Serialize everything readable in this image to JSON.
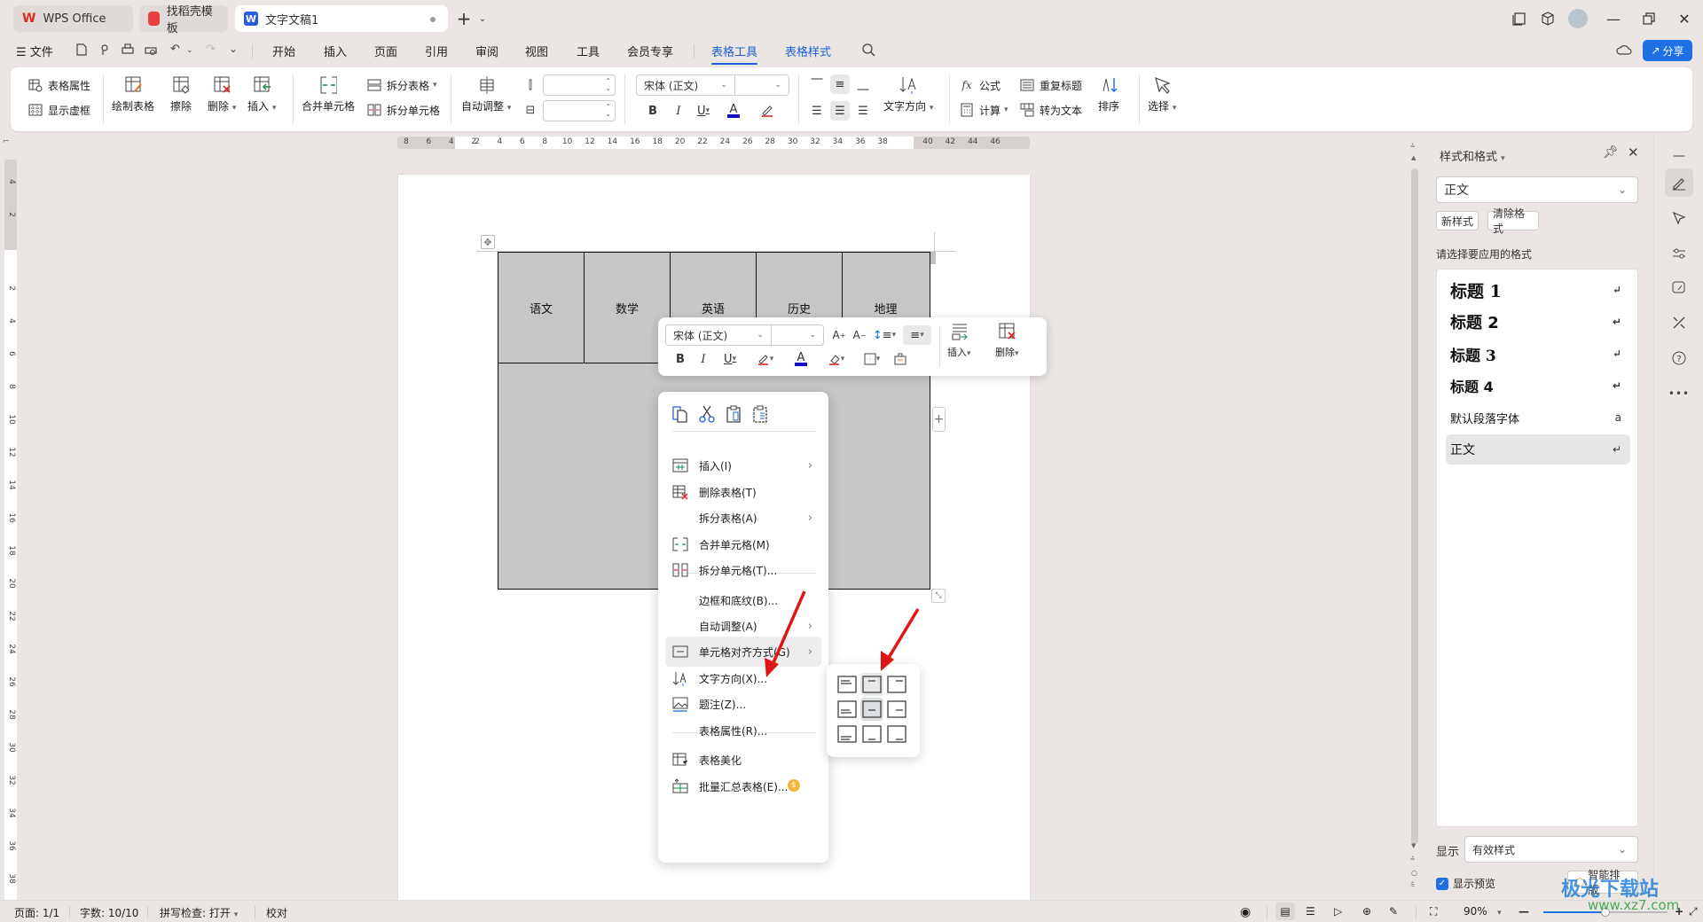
{
  "tabs": [
    {
      "label": "WPS Office",
      "icon": "wps-logo-icon"
    },
    {
      "label": "找稻壳模板",
      "icon": "docer-icon"
    },
    {
      "label": "文字文稿1",
      "icon": "writer-icon",
      "active": true
    }
  ],
  "menu": {
    "file": "文件",
    "items": [
      "开始",
      "插入",
      "页面",
      "引用",
      "审阅",
      "视图",
      "工具",
      "会员专享"
    ],
    "context_tabs": [
      "表格工具",
      "表格样式"
    ],
    "share": "分享"
  },
  "ribbon": {
    "table_props": "表格属性",
    "show_grid": "显示虚框",
    "draw_table": "绘制表格",
    "erase": "擦除",
    "delete": "删除",
    "insert": "插入",
    "merge_cells": "合并单元格",
    "split_table": "拆分表格",
    "split_cells": "拆分单元格",
    "auto_fit": "自动调整",
    "font_name": "宋体 (正文)",
    "font_size": "",
    "row_height": "",
    "col_width": "",
    "text_direction": "文字方向",
    "formula": "公式",
    "calculate": "计算",
    "repeat_header": "重复标题",
    "to_text": "转为文本",
    "sort": "排序",
    "select": "选择"
  },
  "ruler": {
    "h_left": [
      "8",
      "6",
      "4",
      "2"
    ],
    "h_main": [
      "2",
      "4",
      "6",
      "8",
      "10",
      "12",
      "14",
      "16",
      "18",
      "20",
      "22",
      "24",
      "26",
      "28",
      "30",
      "32",
      "34",
      "36",
      "38"
    ],
    "h_right": [
      "40",
      "42",
      "44",
      "46"
    ],
    "v_top": [
      "4",
      "2"
    ],
    "v_main": [
      "2",
      "4",
      "6",
      "8",
      "10",
      "12",
      "14",
      "16",
      "18",
      "20",
      "22",
      "24",
      "26",
      "28",
      "30",
      "32",
      "34",
      "36",
      "38"
    ]
  },
  "document": {
    "table_headers": [
      "语文",
      "数学",
      "英语",
      "历史",
      "地理"
    ]
  },
  "float_toolbar": {
    "font_name": "宋体 (正文)",
    "font_size": "",
    "insert": "插入",
    "delete": "删除"
  },
  "context_menu": {
    "items": [
      {
        "label": "插入(I)",
        "icon": "insert-table-icon",
        "submenu": true
      },
      {
        "label": "删除表格(T)",
        "icon": "delete-table-icon",
        "submenu": false
      },
      {
        "label": "拆分表格(A)",
        "icon": "",
        "submenu": true
      },
      {
        "label": "合并单元格(M)",
        "icon": "merge-cells-icon",
        "submenu": false
      },
      {
        "label": "拆分单元格(T)...",
        "icon": "split-cells-icon",
        "submenu": false
      },
      {
        "label": "边框和底纹(B)...",
        "icon": "",
        "submenu": false
      },
      {
        "label": "自动调整(A)",
        "icon": "",
        "submenu": true
      },
      {
        "label": "单元格对齐方式(G)",
        "icon": "cell-align-icon",
        "submenu": true,
        "highlighted": true
      },
      {
        "label": "文字方向(X)...",
        "icon": "text-direction-icon",
        "submenu": false
      },
      {
        "label": "题注(Z)...",
        "icon": "caption-icon",
        "submenu": false
      },
      {
        "label": "表格属性(R)...",
        "icon": "",
        "submenu": false
      },
      {
        "label": "表格美化",
        "icon": "table-beautify-icon",
        "submenu": false
      },
      {
        "label": "批量汇总表格(E)...",
        "icon": "batch-summary-icon",
        "submenu": false,
        "premium": true
      }
    ],
    "align_grid": [
      [
        "top-left",
        "top-center",
        "top-right"
      ],
      [
        "middle-left",
        "middle-center",
        "middle-right"
      ],
      [
        "bottom-left",
        "bottom-center",
        "bottom-right"
      ]
    ],
    "align_selected": "middle-center"
  },
  "right_panel": {
    "title": "样式和格式",
    "current_style": "正文",
    "new_style": "新样式",
    "clear_format": "清除格式",
    "prompt": "请选择要应用的格式",
    "styles": [
      {
        "label": "标题  1",
        "mark": "↵"
      },
      {
        "label": "标题  2",
        "mark": "↵"
      },
      {
        "label": "标题  3",
        "mark": "↵"
      },
      {
        "label": "标题  4",
        "mark": "↵"
      },
      {
        "label": "默认段落字体",
        "mark": "a"
      },
      {
        "label": "正文",
        "mark": "↵",
        "selected": true
      }
    ],
    "show_label": "显示",
    "show_value": "有效样式",
    "show_preview": "显示预览",
    "show_preview_checked": true,
    "smart_layout": "智能排版"
  },
  "status": {
    "page": "页面: 1/1",
    "words": "字数: 10/10",
    "spell": "拼写检查: 打开",
    "proof": "校对",
    "zoom": "90%",
    "zoom_level": 0.5
  },
  "watermark": {
    "name": "极光下载站",
    "url": "www.xz7.com"
  },
  "colors": {
    "accent": "#1f6fe5",
    "table_fill": "#c6c6c6",
    "annotation": "#e01515"
  }
}
